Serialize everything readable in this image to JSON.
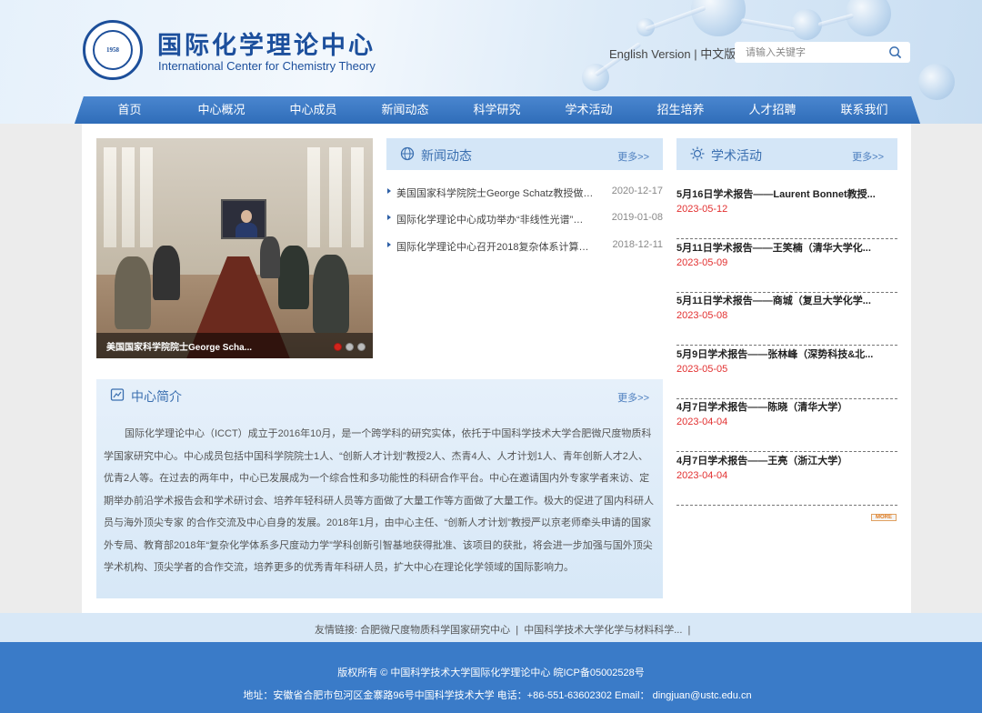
{
  "header": {
    "title_cn": "国际化学理论中心",
    "title_en": "International Center for Chemistry Theory",
    "logo_year": "1958",
    "lang_en": "English Version",
    "lang_sep": "|",
    "lang_cn": "中文版",
    "search_placeholder": "请输入关键字"
  },
  "nav": [
    "首页",
    "中心概况",
    "中心成员",
    "新闻动态",
    "科学研究",
    "学术活动",
    "招生培养",
    "人才招聘",
    "联系我们"
  ],
  "slider": {
    "caption": "美国国家科学院院士George Scha...",
    "dots": 3,
    "active_dot": 0
  },
  "news": {
    "title": "新闻动态",
    "more": "更多>>",
    "items": [
      {
        "title": "美国国家科学院院士George Schatz教授做客…",
        "date": "2020-12-17"
      },
      {
        "title": "国际化学理论中心成功举办“非线性光谱”…",
        "date": "2019-01-08"
      },
      {
        "title": "国际化学理论中心召开2018复杂体系计算统…",
        "date": "2018-12-11"
      }
    ]
  },
  "intro": {
    "title": "中心简介",
    "more": "更多>>",
    "text": "国际化学理论中心（ICCT）成立于2016年10月，是一个跨学科的研究实体，依托于中国科学技术大学合肥微尺度物质科学国家研究中心。中心成员包括中国科学院院士1人、“创新人才计划”教授2人、杰青4人、人才计划1人、青年创新人才2人、优青2人等。在过去的两年中，中心已发展成为一个综合性和多功能性的科研合作平台。中心在邀请国内外专家学者来访、定期举办前沿学术报告会和学术研讨会、培养年轻科研人员等方面做了大量工作等方面做了大量工作。极大的促进了国内科研人员与海外顶尖专家 的合作交流及中心自身的发展。2018年1月，由中心主任、“创新人才计划”教授严以京老师牵头申请的国家外专局、教育部2018年“复杂化学体系多尺度动力学”学科创新引智基地获得批准、该项目的获批，将会进一步加强与国外顶尖学术机构、顶尖学者的合作交流，培养更多的优秀青年科研人员，扩大中心在理论化学领域的国际影响力。"
  },
  "activities": {
    "title": "学术活动",
    "more": "更多>>",
    "badge": "MORE",
    "items": [
      {
        "title": "5月16日学术报告——Laurent Bonnet教授...",
        "date": "2023-05-12"
      },
      {
        "title": "5月11日学术报告——王笑楠（清华大学化...",
        "date": "2023-05-09"
      },
      {
        "title": "5月11日学术报告——商城（复旦大学化学...",
        "date": "2023-05-08"
      },
      {
        "title": "5月9日学术报告——张林峰（深势科技&北...",
        "date": "2023-05-05"
      },
      {
        "title": "4月7日学术报告——陈晓（清华大学）",
        "date": "2023-04-04"
      },
      {
        "title": "4月7日学术报告——王亮（浙江大学）",
        "date": "2023-04-04"
      }
    ]
  },
  "links": {
    "label": "友情链接:",
    "items": [
      "合肥微尺度物质科学国家研究中心",
      "中国科学技术大学化学与材料科学..."
    ],
    "sep": "|"
  },
  "footer": {
    "line1": "版权所有 © 中国科学技术大学国际化学理论中心 皖ICP备05002528号",
    "line2": "地址：安徽省合肥市包河区金寨路96号中国科学技术大学 电话：+86-551-63602302 Email： dingjuan@ustc.edu.cn"
  },
  "colors": {
    "brand": "#1c4f9c",
    "nav": "#3a78c4",
    "footer": "#3a7bc8",
    "date_red": "#e23030"
  }
}
